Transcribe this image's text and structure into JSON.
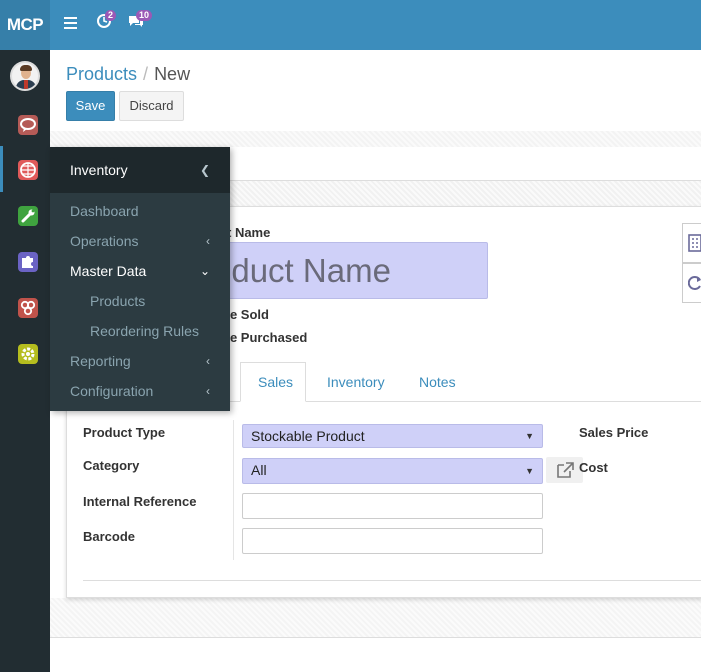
{
  "brand": {
    "logo_text": "MCP"
  },
  "topbar": {
    "menu_icon": "hamburger-icon",
    "activity_icon": "clock-check-icon",
    "activity_count": "2",
    "messages_icon": "comments-icon",
    "messages_count": "10",
    "bar_color": "#3c8dbc"
  },
  "leftbar": {
    "apps": [
      {
        "name": "discuss",
        "icon": "chat-bubble-icon",
        "color": "#b55b57"
      },
      {
        "name": "inventory",
        "icon": "globe-icon",
        "color": "#e05a5a",
        "active": true
      },
      {
        "name": "settings-tools",
        "icon": "wrench-icon",
        "color": "#3fa33f"
      },
      {
        "name": "apps",
        "icon": "puzzle-icon",
        "color": "#6b63c4"
      },
      {
        "name": "integrations",
        "icon": "connections-icon",
        "color": "#c0534b"
      },
      {
        "name": "settings",
        "icon": "gear-icon",
        "color": "#b5bd1e"
      }
    ]
  },
  "menu": {
    "title": "Inventory",
    "items": [
      {
        "label": "Dashboard",
        "chevron": ""
      },
      {
        "label": "Operations",
        "chevron": "‹"
      },
      {
        "label": "Master Data",
        "chevron": "⌄",
        "open": true
      },
      {
        "label": "Products",
        "sub": true
      },
      {
        "label": "Reordering Rules",
        "sub": true
      },
      {
        "label": "Reporting",
        "chevron": "‹"
      },
      {
        "label": "Configuration",
        "chevron": "‹"
      }
    ]
  },
  "breadcrumb": {
    "parent": "Products",
    "separator": "/",
    "current": "New"
  },
  "actions": {
    "save_label": "Save",
    "discard_label": "Discard"
  },
  "form": {
    "name_label_partial": "t Name",
    "name_placeholder_partial": "oduct Name",
    "can_be_sold_partial": "be Sold",
    "can_be_purchased_partial": "be Purchased",
    "tabs": [
      "Sales",
      "Inventory",
      "Notes"
    ],
    "fields": {
      "product_type_label": "Product Type",
      "product_type_value": "Stockable Product",
      "category_label": "Category",
      "category_value": "All",
      "internal_reference_label": "Internal Reference",
      "barcode_label": "Barcode",
      "sales_price_label": "Sales Price",
      "cost_label": "Cost"
    }
  }
}
